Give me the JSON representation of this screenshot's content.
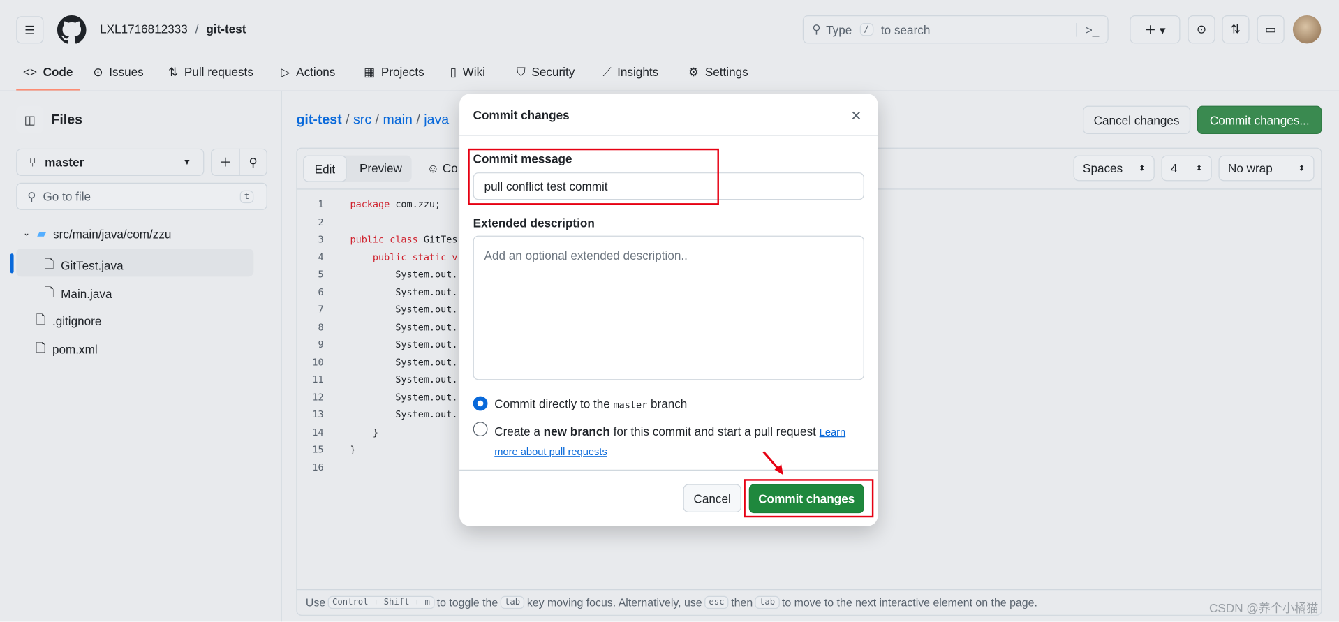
{
  "header": {
    "owner": "LXL1716812333",
    "separator": "/",
    "repo": "git-test",
    "search_prefix": "Type",
    "search_key": "/",
    "search_suffix": "to search"
  },
  "nav": {
    "tabs": [
      {
        "label": "Code",
        "icon": "code-icon",
        "active": true
      },
      {
        "label": "Issues",
        "icon": "issue-icon"
      },
      {
        "label": "Pull requests",
        "icon": "pull-request-icon"
      },
      {
        "label": "Actions",
        "icon": "play-icon"
      },
      {
        "label": "Projects",
        "icon": "table-icon"
      },
      {
        "label": "Wiki",
        "icon": "book-icon"
      },
      {
        "label": "Security",
        "icon": "shield-icon"
      },
      {
        "label": "Insights",
        "icon": "graph-icon"
      },
      {
        "label": "Settings",
        "icon": "gear-icon"
      }
    ]
  },
  "sidebar": {
    "title": "Files",
    "branch": "master",
    "goto_placeholder": "Go to file",
    "goto_key": "t",
    "tree": [
      {
        "label": "src/main/java/com/zzu",
        "type": "folder"
      },
      {
        "label": "GitTest.java",
        "type": "file",
        "selected": true
      },
      {
        "label": "Main.java",
        "type": "file"
      },
      {
        "label": ".gitignore",
        "type": "file"
      },
      {
        "label": "pom.xml",
        "type": "file"
      }
    ]
  },
  "breadcrumb": [
    "git-test",
    "src",
    "main",
    "java"
  ],
  "actions": {
    "cancel": "Cancel changes",
    "commit": "Commit changes..."
  },
  "editor": {
    "tabs": [
      "Edit",
      "Preview",
      "Co"
    ],
    "indent_mode": "Spaces",
    "indent_size": "4",
    "wrap": "No wrap",
    "lines": [
      [
        "package",
        " com.zzu;"
      ],
      [
        "",
        ""
      ],
      [
        "public class",
        " GitTes"
      ],
      [
        "    public static v",
        ""
      ],
      [
        "",
        "        System.out."
      ],
      [
        "",
        "        System.out."
      ],
      [
        "",
        "        System.out."
      ],
      [
        "",
        "        System.out."
      ],
      [
        "",
        "        System.out."
      ],
      [
        "",
        "        System.out."
      ],
      [
        "",
        "        System.out."
      ],
      [
        "",
        "        System.out."
      ],
      [
        "",
        "        System.out."
      ],
      [
        "",
        "    }"
      ],
      [
        "",
        "}"
      ],
      [
        "",
        ""
      ]
    ],
    "hint": {
      "use": "Use",
      "k1": "Control + Shift + m",
      "t1": "to toggle the",
      "k2": "tab",
      "t2": "key moving focus. Alternatively, use",
      "k3": "esc",
      "t3": "then",
      "k4": "tab",
      "t4": "to move to the next interactive element on the page."
    }
  },
  "modal": {
    "title": "Commit changes",
    "message_label": "Commit message",
    "message_value": "pull conflict test commit",
    "desc_label": "Extended description",
    "desc_placeholder": "Add an optional extended description..",
    "opt1_pre": "Commit directly to the",
    "opt1_branch": "master",
    "opt1_post": "branch",
    "opt2_pre": "Create a",
    "opt2_bold": "new branch",
    "opt2_post": "for this commit and start a pull request",
    "learn_link": "Learn more about pull requests",
    "cancel": "Cancel",
    "commit": "Commit changes"
  },
  "watermark": "CSDN @养个小橘猫",
  "colors": {
    "accent_green": "#1f883d",
    "link": "#0969da",
    "annotation_red": "#e60012",
    "tab_underline": "#fd8c73"
  }
}
